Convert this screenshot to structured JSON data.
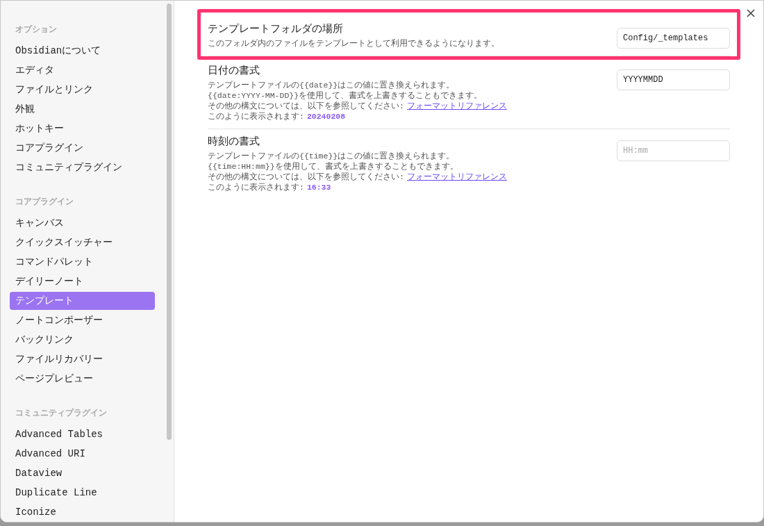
{
  "sidebar": {
    "sections": [
      {
        "heading": "オプション",
        "items": [
          {
            "label": "Obsidianについて",
            "selected": false
          },
          {
            "label": "エディタ",
            "selected": false
          },
          {
            "label": "ファイルとリンク",
            "selected": false
          },
          {
            "label": "外観",
            "selected": false
          },
          {
            "label": "ホットキー",
            "selected": false
          },
          {
            "label": "コアプラグイン",
            "selected": false
          },
          {
            "label": "コミュニティプラグイン",
            "selected": false
          }
        ]
      },
      {
        "heading": "コアプラグイン",
        "items": [
          {
            "label": "キャンバス",
            "selected": false
          },
          {
            "label": "クイックスイッチャー",
            "selected": false
          },
          {
            "label": "コマンドパレット",
            "selected": false
          },
          {
            "label": "デイリーノート",
            "selected": false
          },
          {
            "label": "テンプレート",
            "selected": true
          },
          {
            "label": "ノートコンポーザー",
            "selected": false
          },
          {
            "label": "バックリンク",
            "selected": false
          },
          {
            "label": "ファイルリカバリー",
            "selected": false
          },
          {
            "label": "ページプレビュー",
            "selected": false
          }
        ]
      },
      {
        "heading": "コミュニティプラグイン",
        "items": [
          {
            "label": "Advanced Tables",
            "selected": false
          },
          {
            "label": "Advanced URI",
            "selected": false
          },
          {
            "label": "Dataview",
            "selected": false
          },
          {
            "label": "Duplicate Line",
            "selected": false
          },
          {
            "label": "Iconize",
            "selected": false
          }
        ]
      }
    ]
  },
  "settings": [
    {
      "title": "テンプレートフォルダの場所",
      "highlighted": true,
      "description": [
        "このフォルダ内のファイルをテンプレートとして利用できるようになります。"
      ],
      "field": {
        "value": "Config/_templates"
      }
    },
    {
      "title": "日付の書式",
      "highlighted": false,
      "description": [
        "テンプレートファイルの{{date}}はこの値に置き換えられます。",
        "{{date:YYYY-MM-DD}}を使用して、書式を上書きすることもできます。"
      ],
      "reference": {
        "text": "その他の構文については、以下を参照してください:",
        "link": "フォーマットリファレンス"
      },
      "preview": {
        "text": "このように表示されます:",
        "value": "20240208"
      },
      "field": {
        "value": "YYYYMMDD"
      }
    },
    {
      "title": "時刻の書式",
      "highlighted": false,
      "description": [
        "テンプレートファイルの{{time}}はこの値に置き換えられます。",
        "{{time:HH:mm}}を使用して、書式を上書きすることもできます。"
      ],
      "reference": {
        "text": "その他の構文については、以下を参照してください:",
        "link": "フォーマットリファレンス"
      },
      "preview": {
        "text": "このように表示されます:",
        "value": "16:33"
      },
      "field": {
        "placeholder": "HH:mm"
      }
    }
  ]
}
